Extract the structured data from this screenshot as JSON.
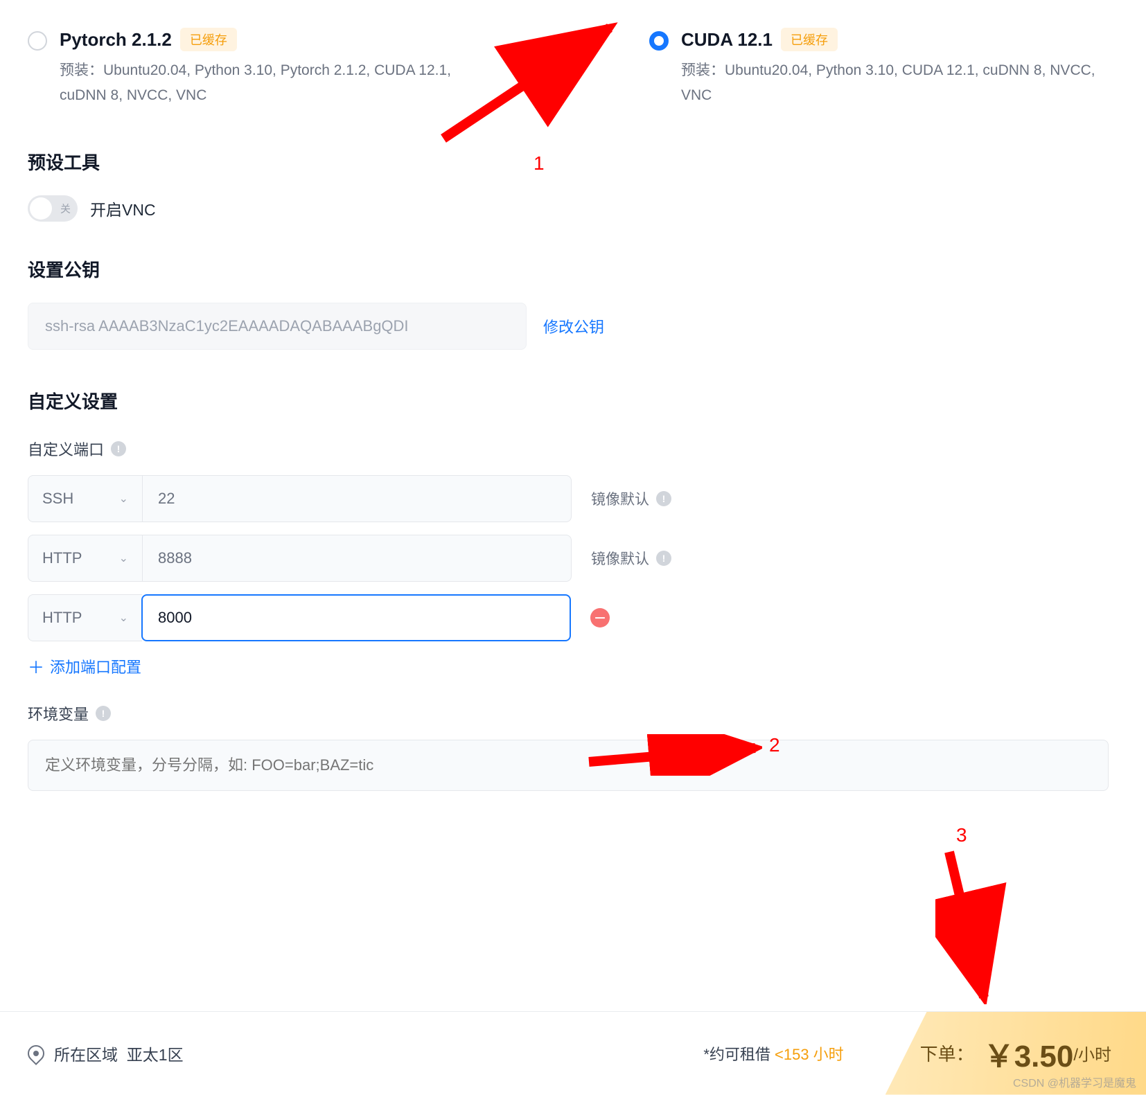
{
  "options": {
    "pytorch": {
      "title": "Pytorch 2.1.2",
      "badge": "已缓存",
      "desc": "预装：Ubuntu20.04, Python 3.10, Pytorch 2.1.2, CUDA 12.1, cuDNN 8, NVCC, VNC"
    },
    "cuda": {
      "title": "CUDA 12.1",
      "badge": "已缓存",
      "desc": "预装：Ubuntu20.04, Python 3.10, CUDA 12.1, cuDNN 8, NVCC, VNC"
    }
  },
  "sections": {
    "preset_tools": "预设工具",
    "vnc_toggle": {
      "off_text": "关",
      "label": "开启VNC"
    },
    "pubkey_title": "设置公钥",
    "pubkey_value": "ssh-rsa AAAAB3NzaC1yc2EAAAADAQABAAABgQDI",
    "pubkey_edit": "修改公钥",
    "custom_title": "自定义设置",
    "custom_port_label": "自定义端口",
    "mirror_default": "镜像默认",
    "add_port": "添加端口配置",
    "env_label": "环境变量",
    "env_placeholder": "定义环境变量，分号分隔，如: FOO=bar;BAZ=tic"
  },
  "ports": [
    {
      "proto": "SSH",
      "value": "22",
      "default": true
    },
    {
      "proto": "HTTP",
      "value": "8888",
      "default": true
    },
    {
      "proto": "HTTP",
      "value": "8000",
      "default": false,
      "active": true
    }
  ],
  "footer": {
    "location_label": "所在区域",
    "location_value": "亚太1区",
    "rent_prefix": "*约可租借 ",
    "rent_hours": "<153 小时",
    "order_label": "下单：",
    "order_currency": "￥",
    "order_price": "3.50",
    "order_unit": "/小时"
  },
  "annotations": {
    "a1": "1",
    "a2": "2",
    "a3": "3"
  },
  "watermark": "CSDN @机器学习是魔鬼"
}
